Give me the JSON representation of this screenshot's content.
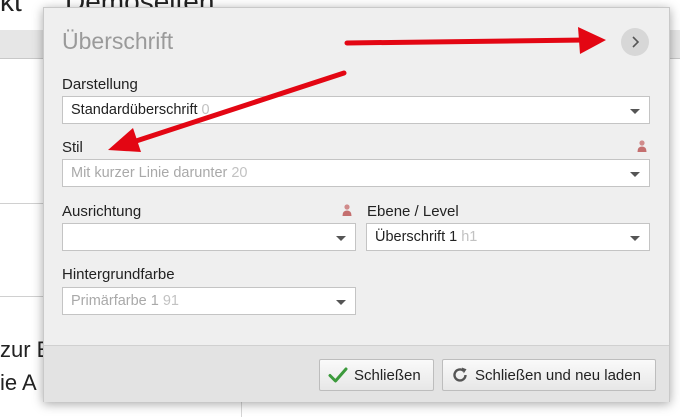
{
  "background": {
    "title_left": "kt",
    "title_right": "Demoseiten",
    "text_line1": "zur E",
    "text_line2": "ie A"
  },
  "dialog": {
    "title": "Überschrift",
    "next_icon": "chevron-right-icon",
    "fields": {
      "darstellung": {
        "label": "Darstellung",
        "value": "Standardüberschrift",
        "suffix": "0"
      },
      "stil": {
        "label": "Stil",
        "placeholder": "Mit kurzer Linie darunter",
        "suffix": "20"
      },
      "ausrichtung": {
        "label": "Ausrichtung",
        "value": ""
      },
      "ebene": {
        "label": "Ebene / Level",
        "value": "Überschrift 1",
        "suffix": "h1"
      },
      "hintergrund": {
        "label": "Hintergrundfarbe",
        "placeholder": "Primärfarbe 1",
        "suffix": "91"
      }
    },
    "footer": {
      "close_label": "Schließen",
      "close_reload_label": "Schließen und neu laden"
    }
  },
  "colors": {
    "annotation_red": "#e30613",
    "check_green": "#3c9a3c"
  }
}
